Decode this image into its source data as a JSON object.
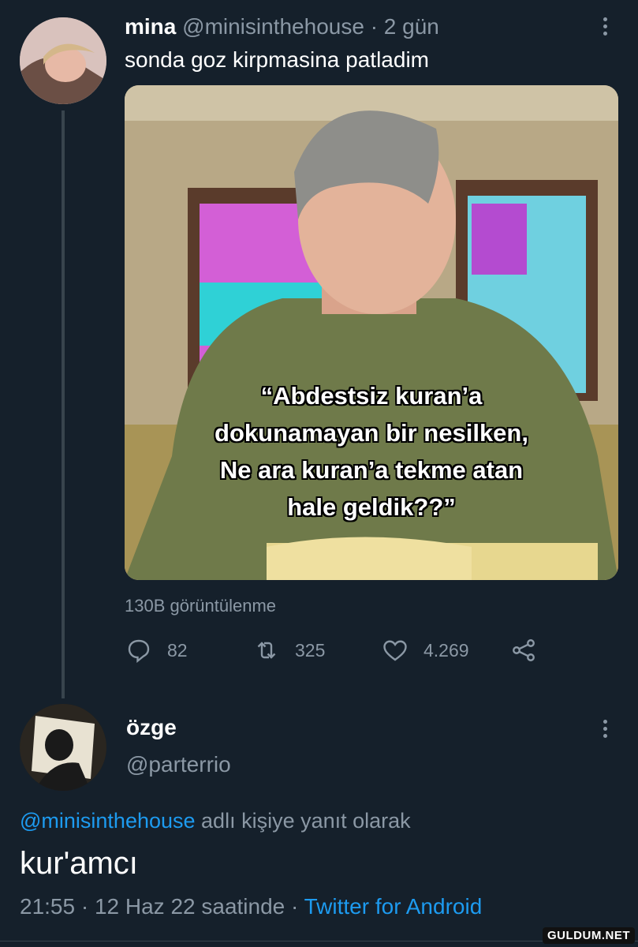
{
  "tweet": {
    "display_name": "mina",
    "handle": "@minisinthehouse",
    "time": "· 2 gün",
    "text": "sonda goz kirpmasina patladim",
    "media_caption": "“Abdestsiz kuran’a\ndokunamayan bir nesilken,\nNe ara kuran’a tekme atan\nhale geldik??”",
    "views": "130B görüntülenme",
    "replies": "82",
    "retweets": "325",
    "likes": "4.269"
  },
  "reply": {
    "display_name": "özge",
    "handle": "@parterrio",
    "replying_to_handle": "@minisinthehouse",
    "replying_to_suffix": " adlı kişiye yanıt olarak",
    "text": "kur'amcı",
    "timestamp": "21:55 · 12 Haz 22 saatinde · ",
    "source": "Twitter for Android"
  },
  "watermark": "GULDUM.NET",
  "icons": [
    "more-icon",
    "reply-icon",
    "retweet-icon",
    "like-icon",
    "share-icon"
  ],
  "colors": {
    "background": "#15202b",
    "muted": "#8b98a5",
    "link": "#1d9bf0",
    "divider": "#38444d"
  }
}
